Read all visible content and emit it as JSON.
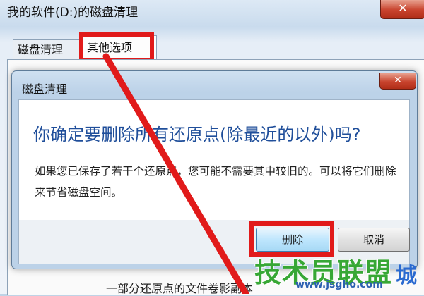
{
  "background_window": {
    "title": "我的软件(D:)的磁盘清理",
    "close_glyph": "✕",
    "tabs": [
      {
        "label": "磁盘清理"
      },
      {
        "label": "其他选项"
      }
    ],
    "bottom_text": "一部分还原点的文件卷影副本"
  },
  "dialog": {
    "title": "磁盘清理",
    "close_glyph": "✕",
    "heading": "你确定要删除所有还原点(除最近的以外)吗?",
    "message": "如果您已保存了若干个还原点，您可能不需要其中较旧的。可以将它们删除来节省磁盘空间。",
    "buttons": {
      "delete_label": "删除",
      "cancel_label": "取消"
    }
  },
  "annotations": {
    "highlight_color": "#e11a1a"
  },
  "watermark": {
    "main": "技术员联盟",
    "side": "城",
    "url": "www.jsgho.com"
  }
}
